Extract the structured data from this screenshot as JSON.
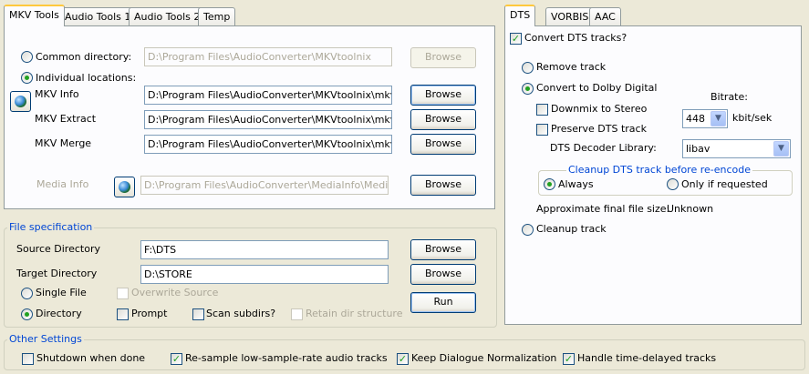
{
  "left_tabs": [
    "MKV Tools",
    "Audio Tools 1",
    "Audio Tools 2",
    "Temp"
  ],
  "right_tabs": [
    "DTS",
    "VORBIS",
    "AAC"
  ],
  "mkv": {
    "common_directory_label": "Common directory:",
    "common_directory_value": "D:\\Program Files\\AudioConverter\\MKVtoolnix",
    "browse_label": "Browse",
    "individual_label": "Individual locations:",
    "rows": [
      {
        "label": "MKV Info",
        "value": "D:\\Program Files\\AudioConverter\\MKVtoolnix\\mkvinfo.e"
      },
      {
        "label": "MKV Extract",
        "value": "D:\\Program Files\\AudioConverter\\MKVtoolnix\\mkvextrac"
      },
      {
        "label": "MKV Merge",
        "value": "D:\\Program Files\\AudioConverter\\MKVtoolnix\\mkvmerge"
      }
    ],
    "media_info_label": "Media Info",
    "media_info_value": "D:\\Program Files\\AudioConverter\\MediaInfo\\MediaInfo."
  },
  "file_spec": {
    "title": "File specification",
    "source_label": "Source Directory",
    "source_value": "F:\\DTS",
    "target_label": "Target Directory",
    "target_value": "D:\\STORE",
    "single_file": "Single File",
    "directory": "Directory",
    "overwrite_source": "Overwrite Source",
    "prompt": "Prompt",
    "scan_subdirs": "Scan subdirs?",
    "retain_dir": "Retain dir structure",
    "run": "Run"
  },
  "other": {
    "title": "Other Settings",
    "shutdown": "Shutdown when done",
    "resample": "Re-sample low-sample-rate audio tracks",
    "keep_dialogue": "Keep Dialogue Normalization",
    "handle_delay": "Handle time-delayed tracks"
  },
  "dts": {
    "convert": "Convert DTS tracks?",
    "remove": "Remove track",
    "to_dolby": "Convert to Dolby Digital",
    "bitrate_label": "Bitrate:",
    "downmix": "Downmix to Stereo",
    "bitrate_value": "448",
    "bitrate_unit": "kbit/sek",
    "preserve": "Preserve DTS track",
    "decoder_label": "DTS Decoder Library:",
    "decoder_value": "libav",
    "cleanup_group": "Cleanup DTS track before re-encode",
    "always": "Always",
    "only_if": "Only if requested",
    "approx_label": "Approximate final file size:",
    "approx_value": "Unknown",
    "cleanup_track": "Cleanup track"
  },
  "colors": {
    "accent": "#0046d5",
    "check": "#21a121",
    "tab_highlight": "#ffc83c"
  }
}
